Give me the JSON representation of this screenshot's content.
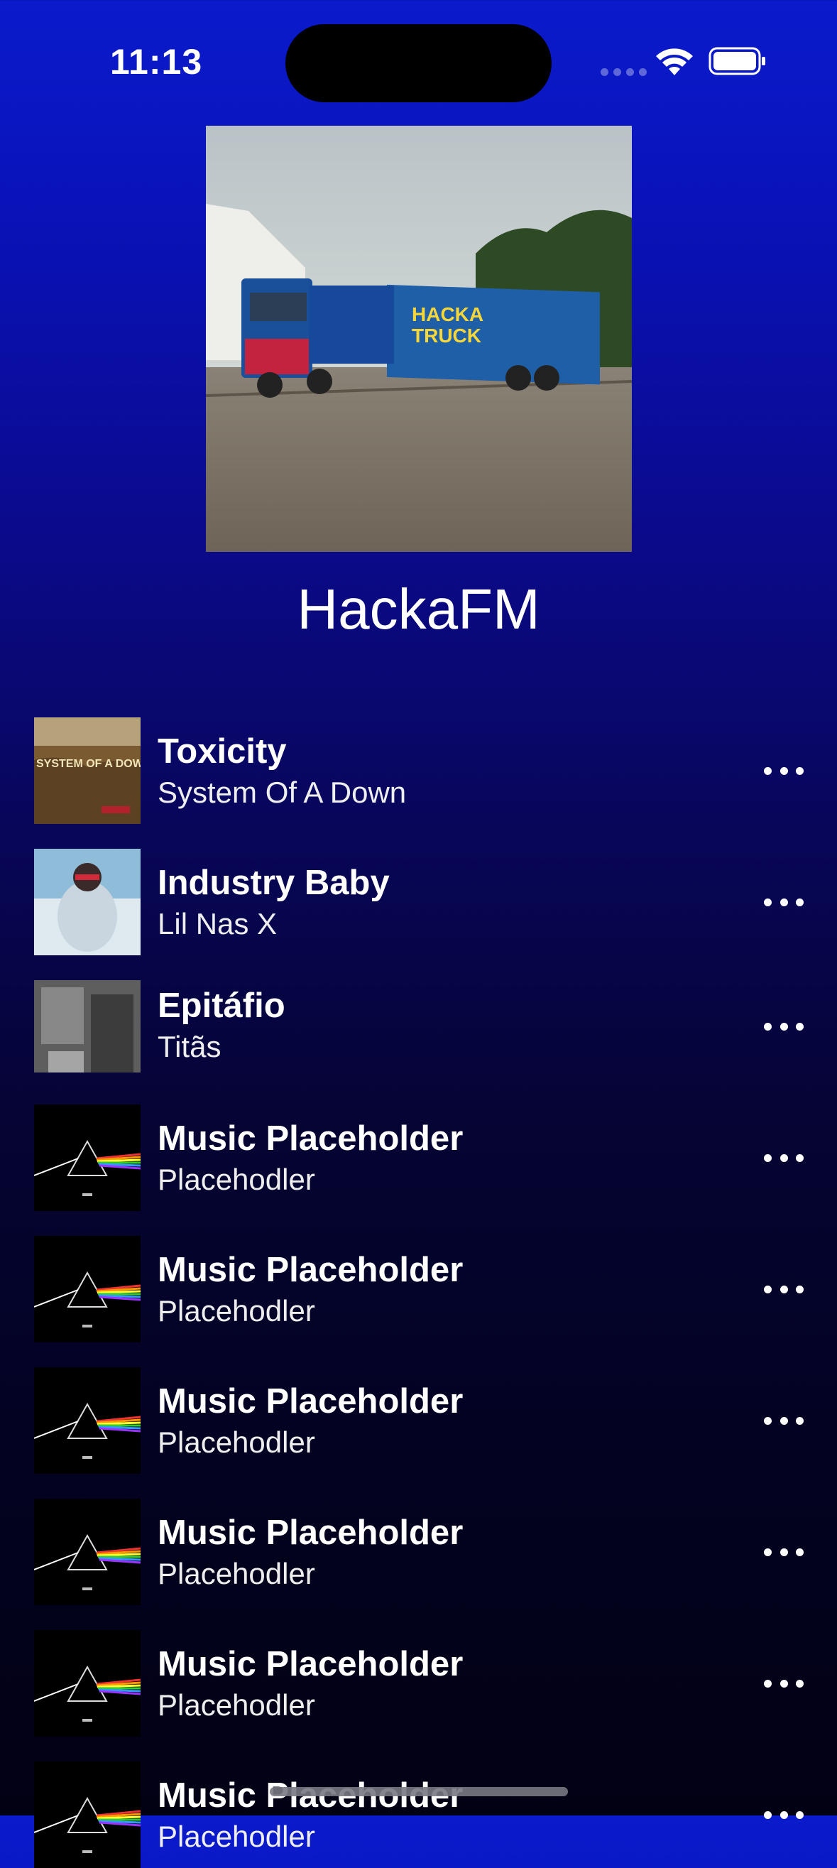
{
  "status_bar": {
    "time": "11:13"
  },
  "station": {
    "name": "HackaFM",
    "cover_text": [
      "HACKA",
      "TRUCK"
    ]
  },
  "songs": [
    {
      "title": "Toxicity",
      "artist": "System Of A Down",
      "art": "toxicity",
      "art_text": "SYSTEM OF A DOWN"
    },
    {
      "title": "Industry Baby",
      "artist": "Lil Nas X",
      "art": "industry"
    },
    {
      "title": "Epitáfio",
      "artist": "Titãs",
      "art": "epitafio"
    },
    {
      "title": "Music Placeholder",
      "artist": "Placehodler",
      "art": "prism"
    },
    {
      "title": "Music Placeholder",
      "artist": "Placehodler",
      "art": "prism"
    },
    {
      "title": "Music Placeholder",
      "artist": "Placehodler",
      "art": "prism"
    },
    {
      "title": "Music Placeholder",
      "artist": "Placehodler",
      "art": "prism"
    },
    {
      "title": "Music Placeholder",
      "artist": "Placehodler",
      "art": "prism"
    },
    {
      "title": "Music Placeholder",
      "artist": "Placehodler",
      "art": "prism"
    }
  ],
  "colors": {
    "accent_top": "#0a1bcc",
    "background_bottom": "#020114",
    "text": "#ffffff"
  },
  "icons": {
    "more": "ellipsis-icon",
    "wifi": "wifi-icon",
    "battery": "battery-icon"
  }
}
